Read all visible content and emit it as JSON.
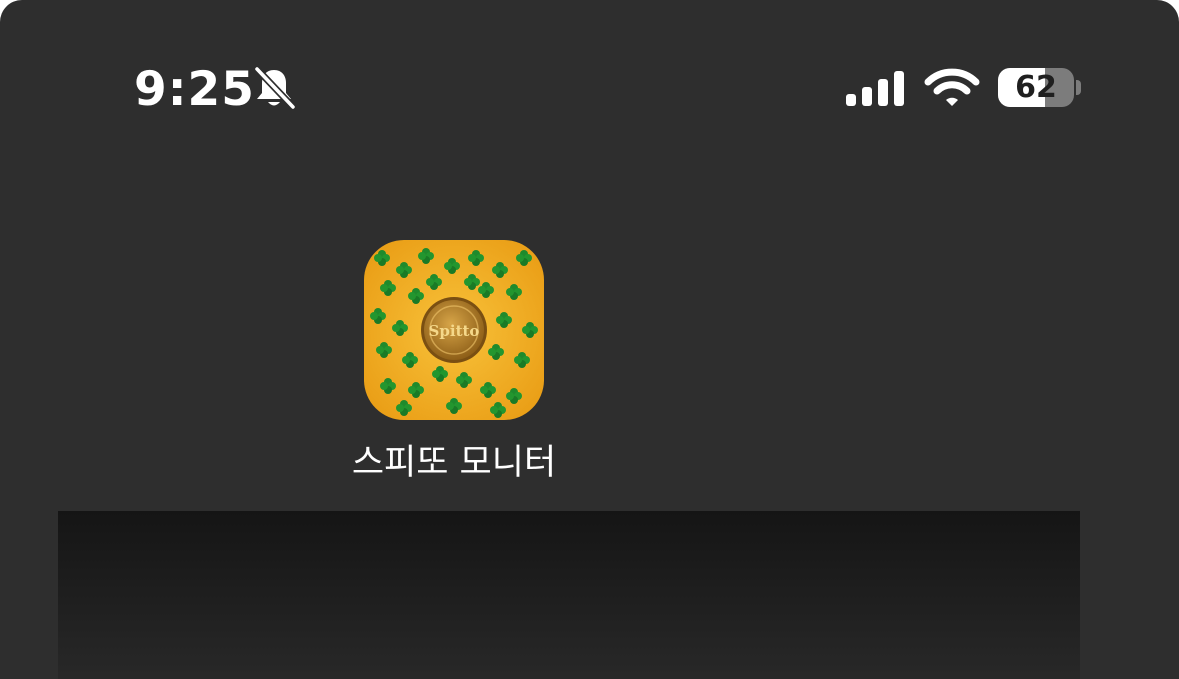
{
  "status_bar": {
    "time": "9:25",
    "battery_level": "62",
    "icons": [
      "bell-slash-icon",
      "cellular-signal-icon",
      "wifi-icon",
      "battery-icon"
    ]
  },
  "app": {
    "label": "스피또 모니터",
    "icon_text": "Spitto",
    "icon_colors": {
      "background": "#f2ac1c",
      "clover": "#1f8a2c",
      "coin": "#b7862a"
    }
  },
  "colors": {
    "screen_background": "#2e2e2e",
    "text": "#ffffff"
  }
}
